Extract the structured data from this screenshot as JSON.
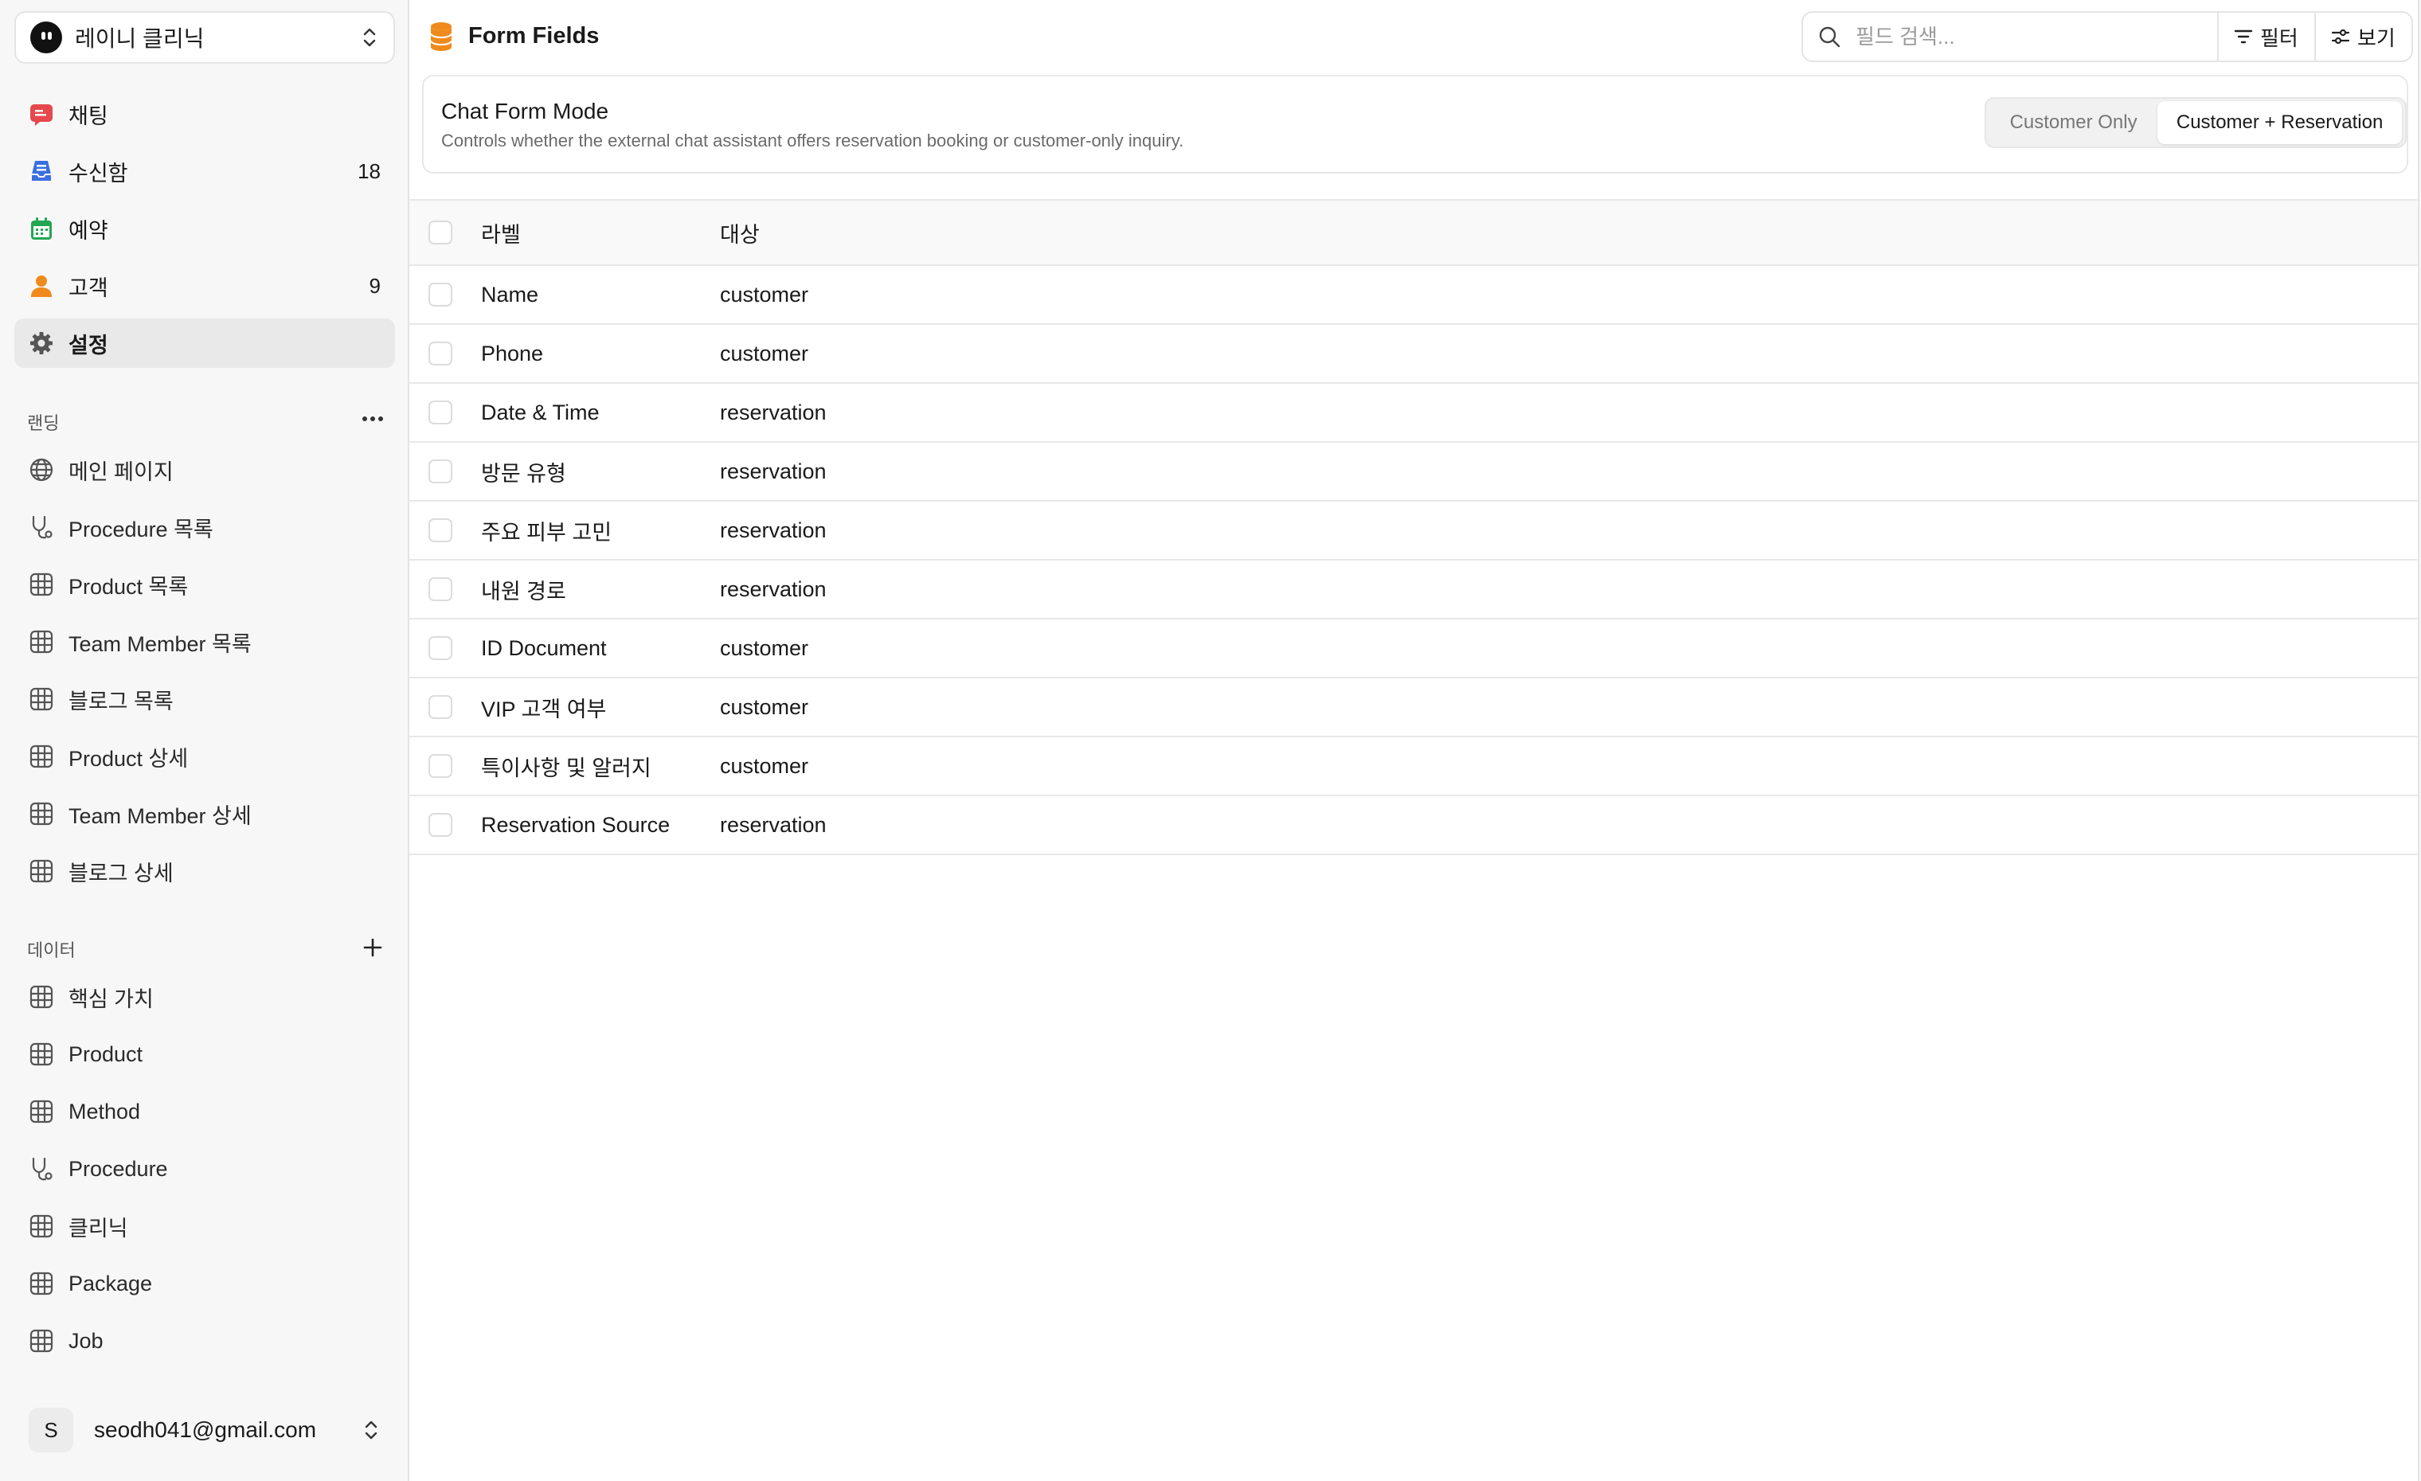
{
  "workspace": {
    "name": "레이니 클리닉"
  },
  "nav": [
    {
      "label": "채팅",
      "count": "",
      "icon": "chat-icon"
    },
    {
      "label": "수신함",
      "count": "18",
      "icon": "inbox-icon"
    },
    {
      "label": "예약",
      "count": "",
      "icon": "calendar-icon"
    },
    {
      "label": "고객",
      "count": "9",
      "icon": "person-icon"
    },
    {
      "label": "설정",
      "count": "",
      "icon": "gear-icon"
    }
  ],
  "landing": {
    "label": "랜딩",
    "items": [
      {
        "label": "메인 페이지",
        "icon": "globe-icon"
      },
      {
        "label": "Procedure 목록",
        "icon": "stethoscope-icon"
      },
      {
        "label": "Product 목록",
        "icon": "table-icon"
      },
      {
        "label": "Team Member 목록",
        "icon": "table-icon"
      },
      {
        "label": "블로그 목록",
        "icon": "table-icon"
      },
      {
        "label": "Product 상세",
        "icon": "table-icon"
      },
      {
        "label": "Team Member 상세",
        "icon": "table-icon"
      },
      {
        "label": "블로그 상세",
        "icon": "table-icon"
      }
    ]
  },
  "data_section": {
    "label": "데이터",
    "items": [
      {
        "label": "핵심 가치",
        "icon": "table-icon"
      },
      {
        "label": "Product",
        "icon": "table-icon"
      },
      {
        "label": "Method",
        "icon": "table-icon"
      },
      {
        "label": "Procedure",
        "icon": "stethoscope-icon"
      },
      {
        "label": "클리닉",
        "icon": "table-icon"
      },
      {
        "label": "Package",
        "icon": "table-icon"
      },
      {
        "label": "Job",
        "icon": "table-icon"
      }
    ]
  },
  "user": {
    "initial": "S",
    "email": "seodh041@gmail.com"
  },
  "header": {
    "title": "Form Fields",
    "search_placeholder": "필드 검색...",
    "filter_label": "필터",
    "view_label": "보기"
  },
  "mode": {
    "title": "Chat Form Mode",
    "description": "Controls whether the external chat assistant offers reservation booking or customer-only inquiry.",
    "options": [
      "Customer Only",
      "Customer + Reservation"
    ],
    "selected": "Customer + Reservation"
  },
  "table": {
    "columns": [
      "라벨",
      "대상"
    ],
    "rows": [
      {
        "label": "Name",
        "target": "customer"
      },
      {
        "label": "Phone",
        "target": "customer"
      },
      {
        "label": "Date & Time",
        "target": "reservation"
      },
      {
        "label": "방문 유형",
        "target": "reservation"
      },
      {
        "label": "주요 피부 고민",
        "target": "reservation"
      },
      {
        "label": "내원 경로",
        "target": "reservation"
      },
      {
        "label": "ID Document",
        "target": "customer"
      },
      {
        "label": "VIP 고객 여부",
        "target": "customer"
      },
      {
        "label": "특이사항 및 알러지",
        "target": "customer"
      },
      {
        "label": "Reservation Source",
        "target": "reservation"
      }
    ]
  },
  "colors": {
    "chat": "#e5484d",
    "inbox": "#3b6fe0",
    "calendar": "#22a652",
    "person": "#f08a1c",
    "title_icon": "#f08a1c"
  }
}
